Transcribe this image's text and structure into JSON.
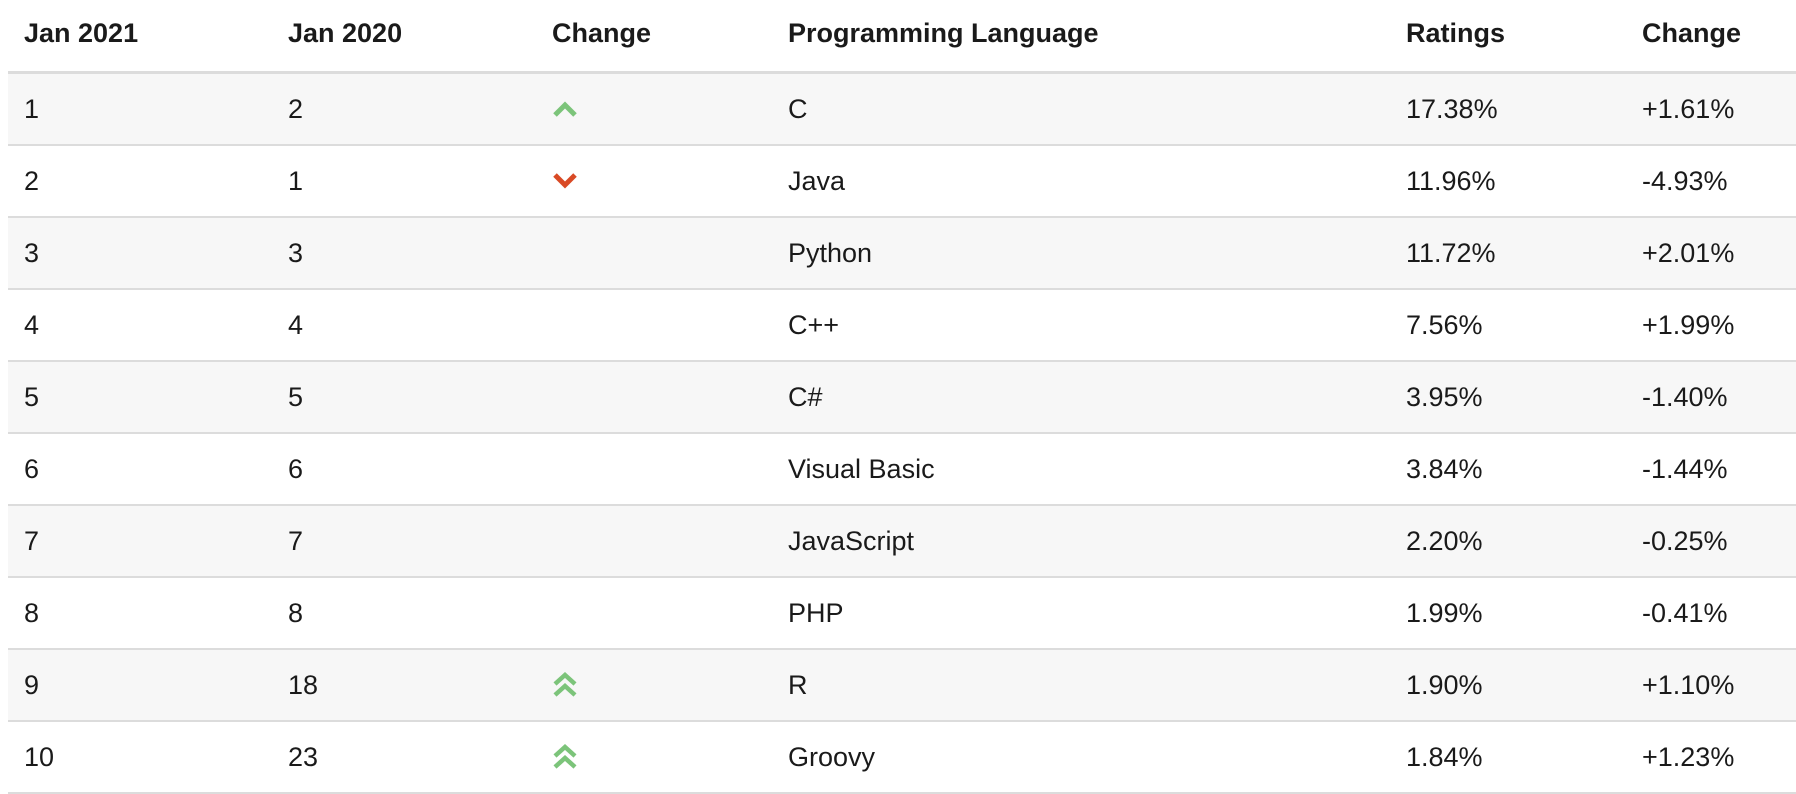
{
  "headers": {
    "rank_now": "Jan 2021",
    "rank_prev": "Jan 2020",
    "change": "Change",
    "language": "Programming Language",
    "ratings": "Ratings",
    "rating_change": "Change"
  },
  "colors": {
    "up": "#7cc47a",
    "down": "#d94a25"
  },
  "rows": [
    {
      "rank": "1",
      "prev": "2",
      "trend": "up",
      "trend_icon": "chevron-up-icon",
      "language": "C",
      "rating": "17.38%",
      "change": "+1.61%"
    },
    {
      "rank": "2",
      "prev": "1",
      "trend": "down",
      "trend_icon": "chevron-down-icon",
      "language": "Java",
      "rating": "11.96%",
      "change": "-4.93%"
    },
    {
      "rank": "3",
      "prev": "3",
      "trend": "none",
      "trend_icon": "",
      "language": "Python",
      "rating": "11.72%",
      "change": "+2.01%"
    },
    {
      "rank": "4",
      "prev": "4",
      "trend": "none",
      "trend_icon": "",
      "language": "C++",
      "rating": "7.56%",
      "change": "+1.99%"
    },
    {
      "rank": "5",
      "prev": "5",
      "trend": "none",
      "trend_icon": "",
      "language": "C#",
      "rating": "3.95%",
      "change": "-1.40%"
    },
    {
      "rank": "6",
      "prev": "6",
      "trend": "none",
      "trend_icon": "",
      "language": "Visual Basic",
      "rating": "3.84%",
      "change": "-1.44%"
    },
    {
      "rank": "7",
      "prev": "7",
      "trend": "none",
      "trend_icon": "",
      "language": "JavaScript",
      "rating": "2.20%",
      "change": "-0.25%"
    },
    {
      "rank": "8",
      "prev": "8",
      "trend": "none",
      "trend_icon": "",
      "language": "PHP",
      "rating": "1.99%",
      "change": "-0.41%"
    },
    {
      "rank": "9",
      "prev": "18",
      "trend": "up2",
      "trend_icon": "double-chevron-up-icon",
      "language": "R",
      "rating": "1.90%",
      "change": "+1.10%"
    },
    {
      "rank": "10",
      "prev": "23",
      "trend": "up2",
      "trend_icon": "double-chevron-up-icon",
      "language": "Groovy",
      "rating": "1.84%",
      "change": "+1.23%"
    }
  ]
}
